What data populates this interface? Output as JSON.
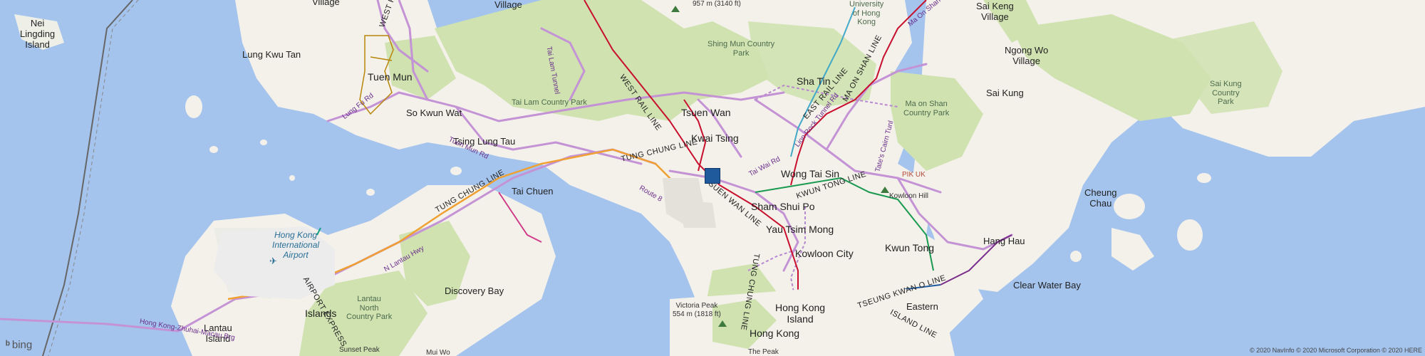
{
  "colors": {
    "water": "#a4c4ee",
    "land": "#f4f1ea",
    "park": "#cfe2b0",
    "road": "#c493d6",
    "rail_red": "#c8102e",
    "rail_orange": "#f0a030",
    "marker": "#1f5a9c"
  },
  "places": {
    "nei_lingding": "Nei\nLingding\nIsland",
    "lung_kwu_tan": "Lung Kwu Tan",
    "tuen_mun": "Tuen Mun",
    "so_kwun_wat": "So Kwun Wat",
    "tsing_lung_tau": "Tsing Lung Tau",
    "tai_lam": "Tai Lam Country Park",
    "tsuen_wan": "Tsuen Wan",
    "kwai_tsing": "Kwai Tsing",
    "shing_mun": "Shing Mun Country\nPark",
    "sha_tin": "Sha Tin",
    "university": "University\nof Hong\nKong",
    "sai_kung": "Sai Kung",
    "sai_kung_country": "Sai Kung\nCountry\nPark",
    "ngong_wo": "Ngong Wo\nVillage",
    "sai_keng": "Sai Keng\nVillage",
    "ma_on_shan": "Ma on Shan\nCountry Park",
    "wong_tai_sin": "Wong Tai Sin",
    "pik_uk": "PIK UK",
    "kowloon_hill": "Kowloon Hill",
    "cheung_chau": "Cheung\nChau",
    "sham_shui_po": "Sham Shui Po",
    "yau_tsim_mong": "Yau Tsim Mong",
    "kowloon_city": "Kowloon City",
    "kwun_tong": "Kwun Tong",
    "hang_hau": "Hang Hau",
    "clear_water_bay": "Clear Water Bay",
    "tai_chuen": "Tai Chuen",
    "hk_airport": "Hong Kong\nInternational\nAirport",
    "discovery_bay": "Discovery Bay",
    "lantau_north": "Lantau\nNorth\nCountry Park",
    "islands": "Islands",
    "lantau_island": "Lantau\nIsland",
    "sunset_peak": "Sunset Peak",
    "mui_wo": "Mui Wo",
    "victoria_peak": "Victoria Peak\n554 m (1818 ft)",
    "hong_kong_island": "Hong Kong\nIsland",
    "hong_kong": "Hong Kong",
    "the_peak": "The Peak",
    "eastern": "Eastern",
    "village": "Village",
    "village_top": "Village",
    "peak_957": "957 m (3140 ft)"
  },
  "lines": {
    "west_rail": "WEST RAIL LINE",
    "west_rail_2": "WEST RAIL LINE",
    "tung_chung": "TUNG CHUNG LINE",
    "tung_chung_2": "TUNG CHUNG LINE",
    "tung_chung_3": "TUNG CHUNG LINE",
    "tsuen_wan": "TSUEN WAN LINE",
    "east_rail": "EAST RAIL LINE",
    "ma_on_shan": "MA ON SHAN LINE",
    "kwun_tong": "KWUN TONG LINE",
    "airport_express": "AIRPORT EXPRESS",
    "tseung_kwan_o": "TSEUNG KWAN O LINE",
    "island": "ISLAND LINE"
  },
  "roads": {
    "tuen_mun_rd": "Tuen Mun Rd",
    "lung_fu_rd": "Lung Fu Rd",
    "tai_lam_tunnel": "Tai Lam Tunnel",
    "route_8": "Route 8",
    "n_lantau_hwy": "N Lantau Hwy",
    "hk_zhuhai_macau": "Hong Kong-Zhuhai-Macau Brg",
    "tai_wai_rd": "Tai Wai Rd",
    "lion_rock_tunnel": "Lion Rock Tunnel Rd",
    "tates_cairn": "Tate's Cairn Tunl",
    "ma_on_shan_rd": "Ma On Shan Rd"
  },
  "map_controls": {
    "logo": "bing",
    "copyright": "© 2020 NavInfo © 2020 Microsoft Corporation © 2020 HERE"
  }
}
